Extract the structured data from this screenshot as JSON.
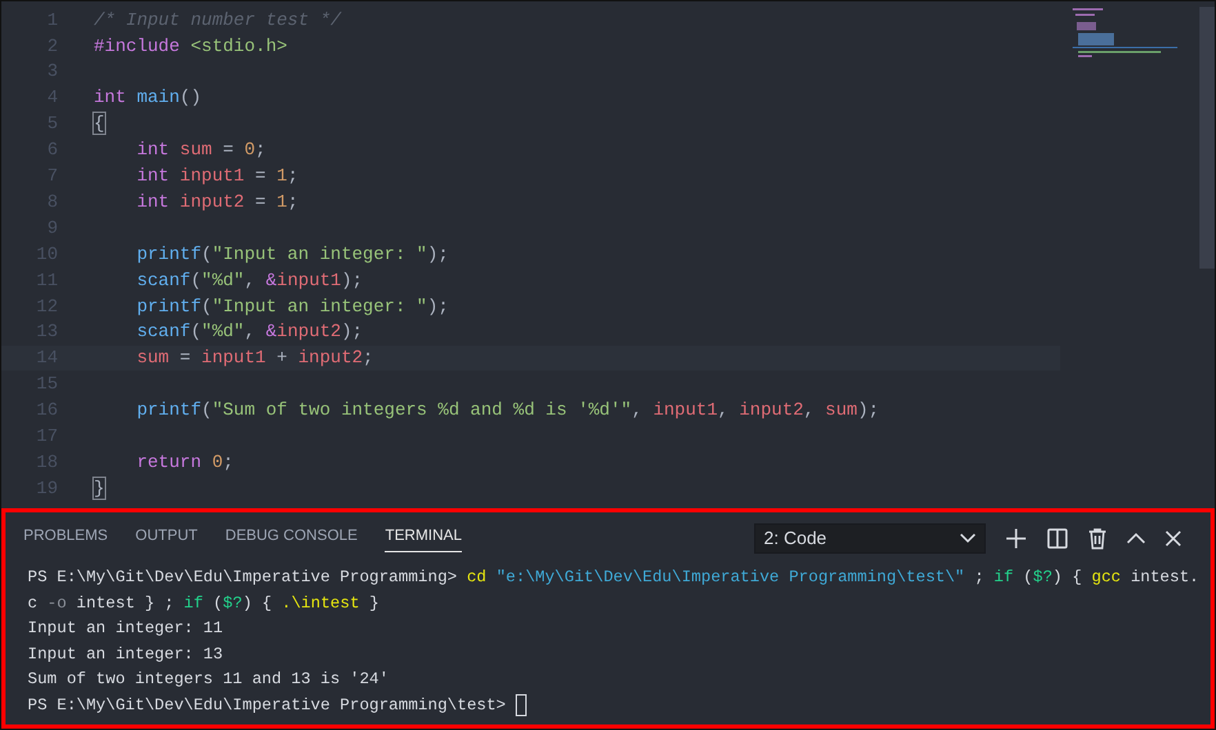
{
  "editor": {
    "lines": [
      {
        "number": "1",
        "current": false,
        "tokens": [
          {
            "kind": "comment",
            "text": "/* Input number test */"
          }
        ]
      },
      {
        "number": "2",
        "current": false,
        "tokens": [
          {
            "kind": "keyword",
            "text": "#include"
          },
          {
            "kind": "string",
            "text": " <stdio.h>"
          }
        ]
      },
      {
        "number": "3",
        "current": false
      },
      {
        "number": "4",
        "current": false,
        "tokens": [
          {
            "kind": "keyword",
            "text": "int"
          },
          {
            "kind": "function",
            "text": " main"
          },
          {
            "kind": "plain",
            "text": "()"
          }
        ]
      },
      {
        "number": "5",
        "current": false,
        "tokens": [
          {
            "kind": "bracket_match",
            "text": "{"
          }
        ]
      },
      {
        "number": "6",
        "current": false,
        "tokens": [
          {
            "kind": "keyword",
            "text": "    int"
          },
          {
            "kind": "variable",
            "text": " sum"
          },
          {
            "kind": "plain",
            "text": " = "
          },
          {
            "kind": "number",
            "text": "0"
          },
          {
            "kind": "plain",
            "text": ";"
          }
        ]
      },
      {
        "number": "7",
        "current": false,
        "tokens": [
          {
            "kind": "keyword",
            "text": "    int"
          },
          {
            "kind": "variable",
            "text": " input1"
          },
          {
            "kind": "plain",
            "text": " = "
          },
          {
            "kind": "number",
            "text": "1"
          },
          {
            "kind": "plain",
            "text": ";"
          }
        ]
      },
      {
        "number": "8",
        "current": false,
        "tokens": [
          {
            "kind": "keyword",
            "text": "    int"
          },
          {
            "kind": "variable",
            "text": " input2"
          },
          {
            "kind": "plain",
            "text": " = "
          },
          {
            "kind": "number",
            "text": "1"
          },
          {
            "kind": "plain",
            "text": ";"
          }
        ]
      },
      {
        "number": "9",
        "current": false
      },
      {
        "number": "10",
        "current": false,
        "tokens": [
          {
            "kind": "function",
            "text": "    printf"
          },
          {
            "kind": "plain",
            "text": "("
          },
          {
            "kind": "string",
            "text": "\"Input an integer: \""
          },
          {
            "kind": "plain",
            "text": ");"
          }
        ]
      },
      {
        "number": "11",
        "current": false,
        "tokens": [
          {
            "kind": "function",
            "text": "    scanf"
          },
          {
            "kind": "plain",
            "text": "("
          },
          {
            "kind": "string",
            "text": "\"%d\""
          },
          {
            "kind": "plain",
            "text": ", "
          },
          {
            "kind": "keyword",
            "text": "&"
          },
          {
            "kind": "variable",
            "text": "input1"
          },
          {
            "kind": "plain",
            "text": ");"
          }
        ]
      },
      {
        "number": "12",
        "current": false,
        "tokens": [
          {
            "kind": "function",
            "text": "    printf"
          },
          {
            "kind": "plain",
            "text": "("
          },
          {
            "kind": "string",
            "text": "\"Input an integer: \""
          },
          {
            "kind": "plain",
            "text": ");"
          }
        ]
      },
      {
        "number": "13",
        "current": false,
        "tokens": [
          {
            "kind": "function",
            "text": "    scanf"
          },
          {
            "kind": "plain",
            "text": "("
          },
          {
            "kind": "string",
            "text": "\"%d\""
          },
          {
            "kind": "plain",
            "text": ", "
          },
          {
            "kind": "keyword",
            "text": "&"
          },
          {
            "kind": "variable",
            "text": "input2"
          },
          {
            "kind": "plain",
            "text": ");"
          }
        ]
      },
      {
        "number": "14",
        "current": true,
        "tokens": [
          {
            "kind": "variable",
            "text": "    sum"
          },
          {
            "kind": "plain",
            "text": " = "
          },
          {
            "kind": "variable",
            "text": "input1"
          },
          {
            "kind": "plain",
            "text": " + "
          },
          {
            "kind": "variable",
            "text": "input2"
          },
          {
            "kind": "plain",
            "text": ";"
          }
        ]
      },
      {
        "number": "15",
        "current": false
      },
      {
        "number": "16",
        "current": false,
        "tokens": [
          {
            "kind": "function",
            "text": "    printf"
          },
          {
            "kind": "plain",
            "text": "("
          },
          {
            "kind": "string",
            "text": "\"Sum of two integers %d and %d is '%d'\""
          },
          {
            "kind": "plain",
            "text": ", "
          },
          {
            "kind": "variable",
            "text": "input1"
          },
          {
            "kind": "plain",
            "text": ", "
          },
          {
            "kind": "variable",
            "text": "input2"
          },
          {
            "kind": "plain",
            "text": ", "
          },
          {
            "kind": "variable",
            "text": "sum"
          },
          {
            "kind": "plain",
            "text": ");"
          }
        ]
      },
      {
        "number": "17",
        "current": false
      },
      {
        "number": "18",
        "current": false,
        "tokens": [
          {
            "kind": "keyword",
            "text": "    return"
          },
          {
            "kind": "number",
            "text": " 0"
          },
          {
            "kind": "plain",
            "text": ";"
          }
        ]
      },
      {
        "number": "19",
        "current": false,
        "tokens": [
          {
            "kind": "bracket_match",
            "text": "}"
          }
        ]
      }
    ]
  },
  "panel": {
    "highlighted": true,
    "tabs": [
      {
        "label": "PROBLEMS",
        "selected": false
      },
      {
        "label": "OUTPUT",
        "selected": false
      },
      {
        "label": "DEBUG CONSOLE",
        "selected": false
      },
      {
        "label": "TERMINAL",
        "selected": true
      }
    ],
    "terminal_select": {
      "value": "2: Code"
    },
    "terminal_lines": [
      [
        {
          "kind": "plain",
          "text": "PS E:\\My\\Git\\Dev\\Edu\\Imperative Programming> "
        },
        {
          "kind": "command",
          "text": "cd"
        },
        {
          "kind": "string",
          "text": " \"e:\\My\\Git\\Dev\\Edu\\Imperative Programming\\test\\\""
        },
        {
          "kind": "plain",
          "text": " ; "
        },
        {
          "kind": "keyword",
          "text": "if"
        },
        {
          "kind": "plain",
          "text": " ("
        },
        {
          "kind": "keyword",
          "text": "$?"
        },
        {
          "kind": "plain",
          "text": ") { "
        },
        {
          "kind": "command",
          "text": "gcc"
        },
        {
          "kind": "plain",
          "text": " intest."
        }
      ],
      [
        {
          "kind": "plain",
          "text": "c "
        },
        {
          "kind": "dim",
          "text": "-o"
        },
        {
          "kind": "plain",
          "text": " intest } ; "
        },
        {
          "kind": "keyword",
          "text": "if"
        },
        {
          "kind": "plain",
          "text": " ("
        },
        {
          "kind": "keyword",
          "text": "$?"
        },
        {
          "kind": "plain",
          "text": ") { "
        },
        {
          "kind": "command",
          "text": ".\\intest"
        },
        {
          "kind": "plain",
          "text": " }"
        }
      ],
      [
        {
          "kind": "plain",
          "text": "Input an integer: 11"
        }
      ],
      [
        {
          "kind": "plain",
          "text": "Input an integer: 13"
        }
      ],
      [
        {
          "kind": "plain",
          "text": "Sum of two integers 11 and 13 is '24'"
        }
      ],
      [
        {
          "kind": "plain",
          "text": "PS E:\\My\\Git\\Dev\\Edu\\Imperative Programming\\test> "
        }
      ]
    ]
  }
}
